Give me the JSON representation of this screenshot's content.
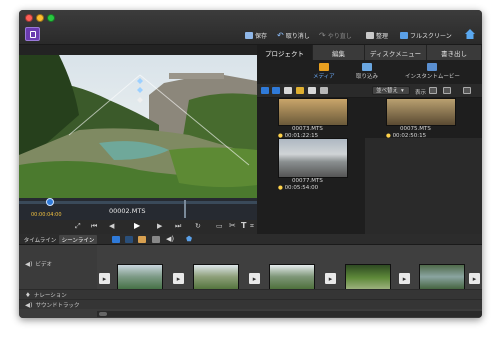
{
  "toolbar": {
    "save": "保存",
    "undo": "取り消し",
    "redo": "やり直し",
    "organize": "整理",
    "fullscreen": "フルスクリーン"
  },
  "preview": {
    "clip_name": "00002.MTS",
    "timecode": "00:00:04:00"
  },
  "panel": {
    "tabs": [
      "プロジェクト",
      "編集",
      "ディスクメニュー",
      "書き出し"
    ],
    "media_label": "メディア",
    "import_label": "取り込み",
    "instant_movie_label": "インスタントムービー",
    "sort_label": "並べ替え",
    "display_label": "表示",
    "clips": [
      {
        "name": "00073.MTS",
        "duration": "00:01:22:15"
      },
      {
        "name": "00075.MTS",
        "duration": "00:02:50:15"
      },
      {
        "name": "00077.MTS",
        "duration": "00:05:54:00"
      }
    ]
  },
  "bottom": {
    "timeline_tab": "タイムライン",
    "sceneline_tab": "シーンライン",
    "tracks": [
      "ビデオ",
      "ナレーション",
      "サウンドトラック"
    ]
  },
  "colors": {
    "accent_blue": "#2f7ad9",
    "timecode_yellow": "#f0c040",
    "app_icon_purple": "#6a3bb0"
  }
}
